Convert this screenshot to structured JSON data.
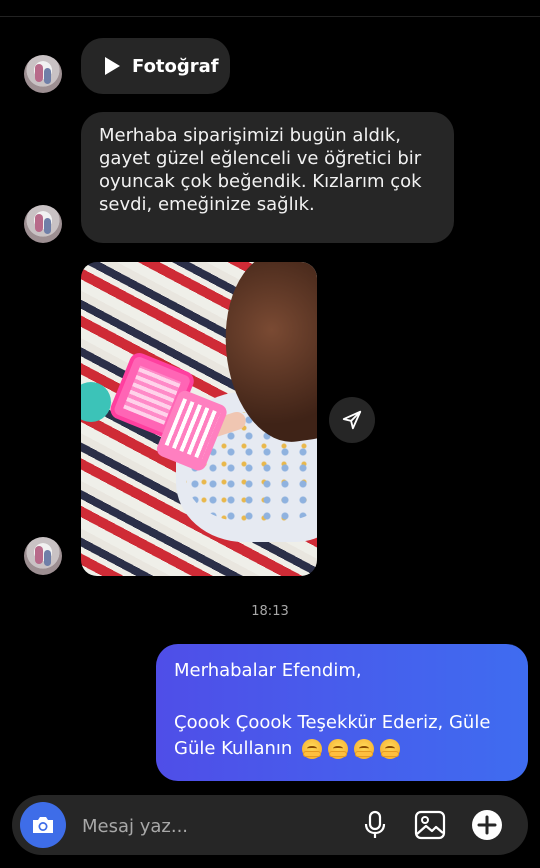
{
  "thread": {
    "media_label": "Fotoğraf",
    "incoming_message": "Merhaba siparişimizi bugün aldık, gayet güzel eğlenceli ve öğretici bir oyuncak çok beğendik. Kızlarım çok sevdi, emeğinize sağlık.",
    "timestamp": "18:13",
    "outgoing_line1": "Merhabalar Efendim,",
    "outgoing_line2": "Çoook Çoook Teşekkür Ederiz, Güle Güle Kullanın"
  },
  "composer": {
    "placeholder": "Mesaj yaz..."
  },
  "icons": {
    "media": "play-icon",
    "share": "send-icon",
    "camera": "camera-icon",
    "mic": "microphone-icon",
    "gallery": "gallery-icon",
    "plus": "plus-circle-icon",
    "emoji": "hugging-face-emoji"
  },
  "colors": {
    "background": "#000000",
    "incoming_bubble": "#262626",
    "outgoing_bubble": "#4f4ee8",
    "camera_button": "#3e6de8"
  }
}
